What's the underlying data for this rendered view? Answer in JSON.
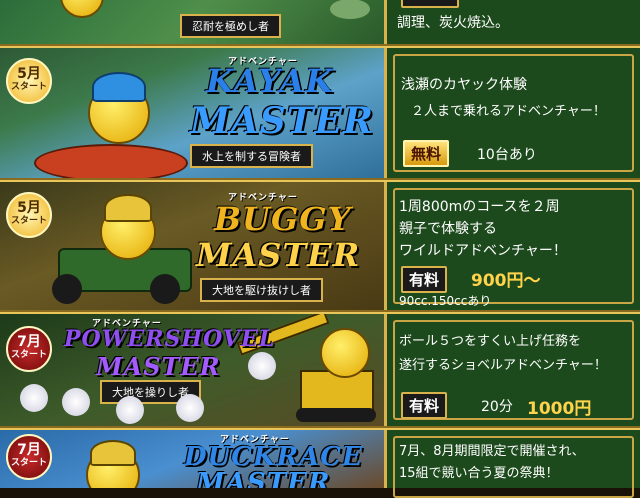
{
  "rows": [
    {
      "sub": "忍耐を極めし者",
      "lines": [
        "調理、炭火焼込。"
      ]
    },
    {
      "month": "5月",
      "start": "スタート",
      "adv": "アドベンチャー",
      "title1": "KAYAK",
      "title2": "MASTER",
      "sub": "水上を制する冒険者",
      "lines": [
        "浅瀬のカヤック体験",
        "２人まで乗れるアドベンチャー！"
      ],
      "badge": "無料",
      "note": "10台あり"
    },
    {
      "month": "5月",
      "start": "スタート",
      "adv": "アドベンチャー",
      "title1": "BUGGY",
      "title2": "MASTER",
      "sub": "大地を駆け抜けし者",
      "lines": [
        "1周800mのコースを２周",
        "親子で体験する",
        "ワイルドアドベンチャー！"
      ],
      "badge": "有料",
      "price": "900円〜",
      "note": "90cc.150ccあり"
    },
    {
      "month": "7月",
      "start": "スタート",
      "adv": "アドベンチャー",
      "title1": "POWERSHOVEL",
      "title2": "MASTER",
      "sub": "大地を操りし者",
      "lines": [
        "ボール５つをすくい上げ任務を",
        "遂行するショベルアドベンチャー！"
      ],
      "badge": "有料",
      "note": "20分",
      "price": "1000円"
    },
    {
      "month": "7月",
      "start": "スタート",
      "adv": "アドベンチャー",
      "title1": "DUCKRACE",
      "title2": "MASTER",
      "lines": [
        "7月、8月期間限定で開催され、",
        "15組で競い合う夏の祭典！"
      ]
    }
  ],
  "colors": {
    "kayak": "#1e6fd6",
    "buggy": "#f0b51e",
    "shovel": "#7a3fe0",
    "duck": "#2d86e8"
  }
}
